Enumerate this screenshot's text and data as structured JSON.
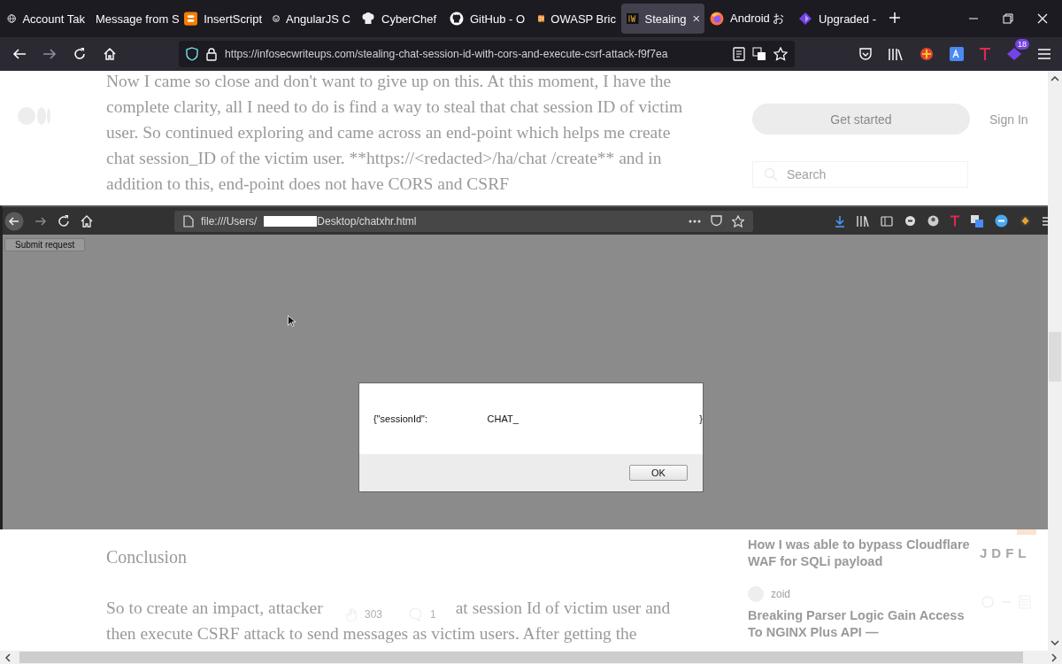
{
  "browser": {
    "tabs": [
      {
        "title": "Account Tak",
        "selected": false
      },
      {
        "title": "Message from S",
        "selected": false
      },
      {
        "title": "InsertScript",
        "selected": false
      },
      {
        "title": "AngularJS C",
        "selected": false
      },
      {
        "title": "CyberChef",
        "selected": false
      },
      {
        "title": "GitHub - O",
        "selected": false
      },
      {
        "title": "OWASP Bric",
        "selected": false
      },
      {
        "title": "Stealing",
        "selected": true
      },
      {
        "title": "Android お",
        "selected": false
      },
      {
        "title": "Upgraded -",
        "selected": false
      }
    ],
    "url": "https://infosecwriteups.com/stealing-chat-session-id-with-cors-and-execute-csrf-attack-f9f7ea",
    "extension_badge": "18"
  },
  "article_top": {
    "paragraph": "Now I came so close and don't want to give up on this. At this moment, I have the complete clarity, all I need to do is find a way to steal that chat session ID of victim user. So continued exploring and came across an end-point which helps me create chat session_ID of the victim user. **https://<redacted>/ha/chat /create** and in addition to this, end-point does not have CORS and CSRF",
    "get_started": "Get started",
    "sign_in": "Sign In",
    "search_placeholder": "Search"
  },
  "embedded_screenshot": {
    "url_start": "file:///Users/",
    "url_end": "Desktop/chatxhr.html",
    "button": "Submit request",
    "dialog": {
      "text_start": "{\"sessionId\":",
      "text_mid": "CHAT_",
      "text_end": "}",
      "ok": "OK"
    }
  },
  "article_bottom": {
    "heading": "Conclusion",
    "line_1_start": "So to create an impact, attacker",
    "line_1_end": "at session Id of victim user and",
    "line_2": "then execute CSRF attack to send messages as victim users. After getting the",
    "claps": "303",
    "comments": "1"
  },
  "sidebar_stories": [
    {
      "title": "How I was able to bypass Cloudflare WAF for SQLi payload",
      "publication_logo": "JDFL"
    },
    {
      "author": "zoid",
      "title": "Breaking Parser Logic Gain Access To NGINX Plus API —"
    }
  ]
}
